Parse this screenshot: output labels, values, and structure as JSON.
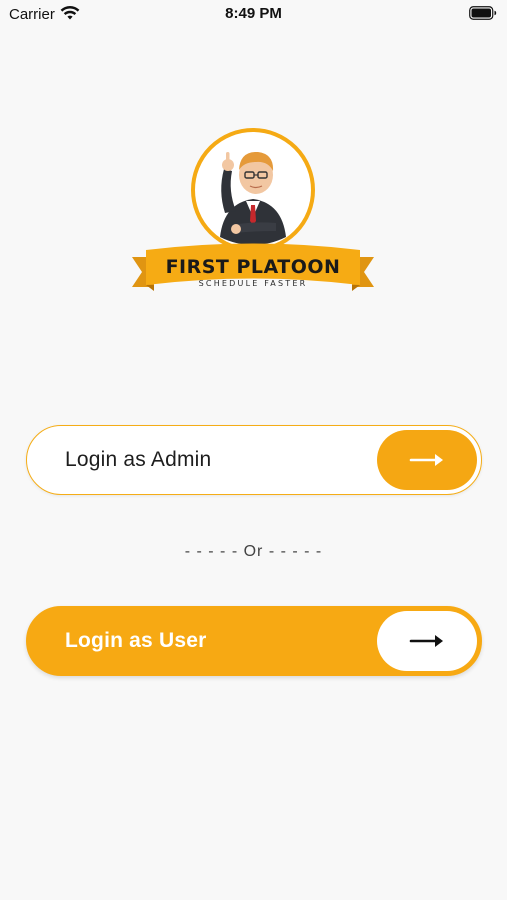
{
  "status_bar": {
    "carrier": "Carrier",
    "time": "8:49 PM"
  },
  "logo": {
    "title": "FIRST PLATOON",
    "tagline": "SCHEDULE FASTER"
  },
  "admin_button": {
    "label": "Login as Admin"
  },
  "separator": {
    "text": "- - - - - Or - - - - -"
  },
  "user_button": {
    "label": "Login as User"
  },
  "colors": {
    "accent": "#f7a913",
    "background": "#f8f8f8",
    "text_dark": "#1e1e1e"
  }
}
